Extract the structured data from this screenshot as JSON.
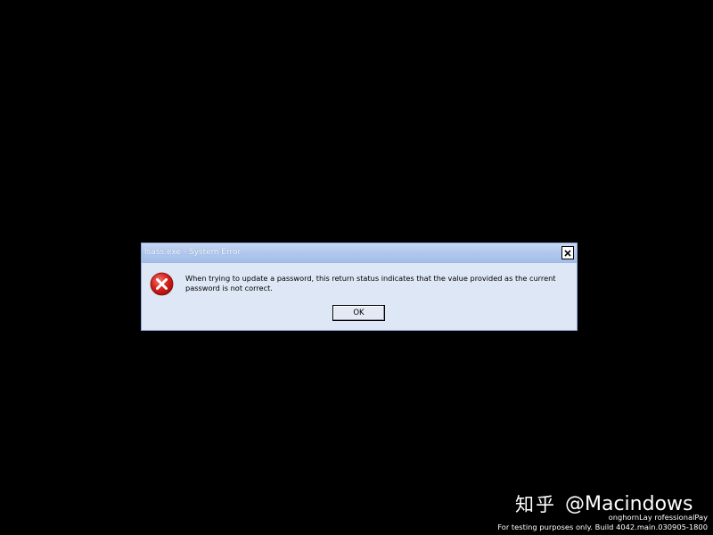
{
  "dialog": {
    "title": "lsass.exe - System Error",
    "message": "When trying to update a password, this return status indicates that the value provided as the current password is not correct.",
    "ok_label": "OK",
    "icon": "error-icon",
    "close_icon": "close-icon"
  },
  "watermark": {
    "logo": "知乎",
    "handle": "@Macindows"
  },
  "build_info": {
    "line1": "onghornLay rofessionalPay",
    "line2": "For testing purposes only. Build 4042.main.030905-1800"
  },
  "colors": {
    "desktop": "#000000",
    "dialog_bg": "#dde7f5",
    "titlebar": "#a3bde9",
    "error_red": "#d8201c"
  }
}
